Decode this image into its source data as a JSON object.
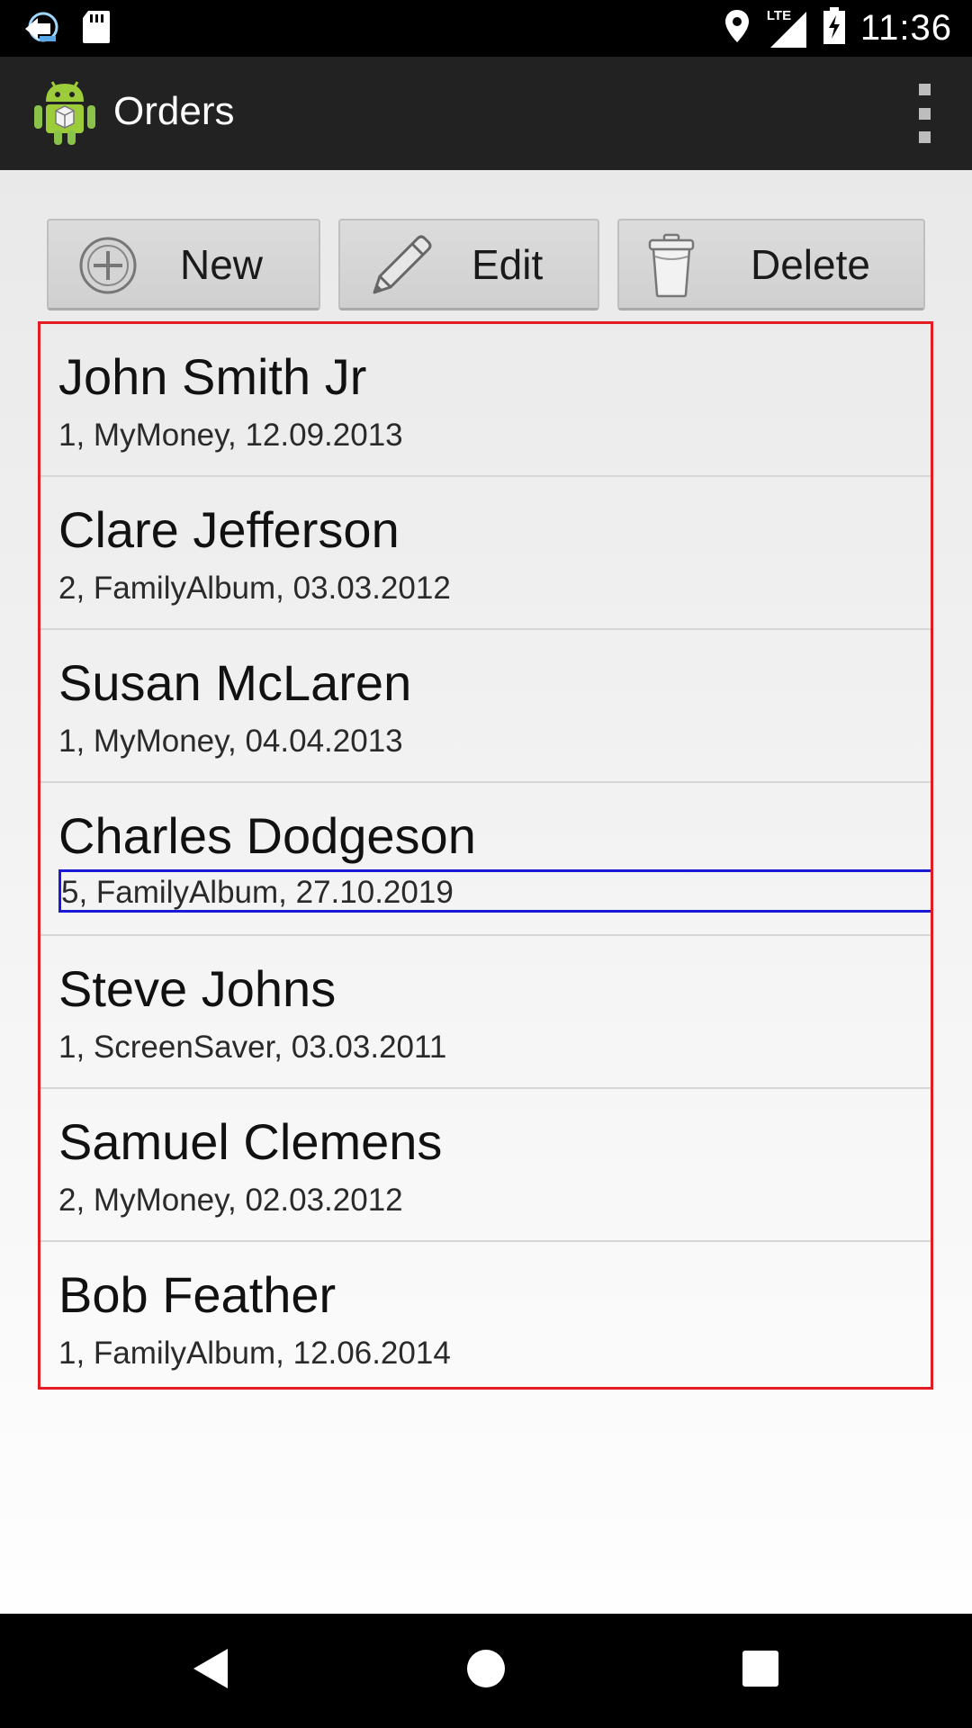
{
  "status_bar": {
    "time": "11:36",
    "network_label": "LTE",
    "icons": [
      "notification-icon",
      "sd-card-icon",
      "location-icon",
      "lte-signal-icon",
      "battery-charging-icon"
    ]
  },
  "action_bar": {
    "title": "Orders",
    "icons": [
      "app-android-icon",
      "overflow-menu-icon"
    ]
  },
  "toolbar": {
    "new_label": "New",
    "edit_label": "Edit",
    "delete_label": "Delete",
    "icons": [
      "plus-circle-icon",
      "pencil-icon",
      "trash-can-icon"
    ]
  },
  "orders": [
    {
      "name": "John Smith Jr",
      "details": "1, MyMoney, 12.09.2013"
    },
    {
      "name": "Clare Jefferson",
      "details": "2, FamilyAlbum, 03.03.2012"
    },
    {
      "name": "Susan McLaren",
      "details": "1, MyMoney, 04.04.2013"
    },
    {
      "name": "Charles Dodgeson",
      "details": "5, FamilyAlbum, 27.10.2019"
    },
    {
      "name": "Steve Johns",
      "details": "1, ScreenSaver, 03.03.2011"
    },
    {
      "name": "Samuel Clemens",
      "details": "2, MyMoney, 02.03.2012"
    },
    {
      "name": "Bob Feather",
      "details": "1, FamilyAlbum, 12.06.2014"
    }
  ],
  "selected_order_index": 3,
  "colors": {
    "list_border": "#e31b23",
    "selection_border": "#1a1ad6",
    "action_bar": "#222222"
  },
  "nav_bar": {
    "icons": [
      "back-icon",
      "home-icon",
      "recents-icon"
    ]
  }
}
